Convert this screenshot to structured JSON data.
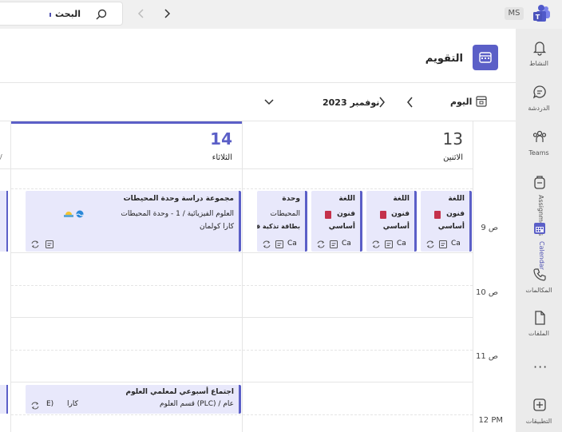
{
  "topbar": {
    "search_label": "البحث",
    "account_badge": "MS"
  },
  "rail": {
    "items": [
      {
        "label": "النشاط",
        "icon": "bell-icon"
      },
      {
        "label": "الدردشة",
        "icon": "chat-icon"
      },
      {
        "label": "Teams",
        "icon": "teams-icon"
      },
      {
        "label": "Assignments",
        "icon": "backpack-icon"
      },
      {
        "label": "Calendar",
        "icon": "calendar-icon"
      },
      {
        "label": "المكالمات",
        "icon": "phone-icon"
      },
      {
        "label": "الملفات",
        "icon": "file-icon"
      },
      {
        "label": "التطبيقات",
        "icon": "add-apps-icon"
      }
    ],
    "more": "···"
  },
  "header": {
    "title": "التقويم"
  },
  "toolbar": {
    "today_label": "اليوم",
    "month_label": "نوفمبر 2023"
  },
  "days": [
    {
      "number": "13",
      "name": "الاثنين"
    },
    {
      "number": "14",
      "name": "الثلاثاء"
    }
  ],
  "times": [
    "9 ص",
    "10 ص",
    "11 ص",
    "12 PM"
  ],
  "events": {
    "mon1": {
      "line1": "اللغة",
      "line2": "فنون",
      "line3": "أساسي",
      "foot": "Ca"
    },
    "mon2": {
      "line1": "اللغة",
      "line2": "فنون",
      "line3": "أساسي",
      "foot": "Ca"
    },
    "tue1": {
      "line1": "اللغة",
      "line2": "فنون",
      "line3": "أساسي",
      "foot": "Ca"
    },
    "tue2": {
      "line1": "وحدة",
      "line2": "المحيطات",
      "line3": "بطاقة تذكية قطبية",
      "foot": "Ca"
    },
    "tue3": {
      "line1": "مجموعة دراسة وحدة المحيطات",
      "line2": "العلوم الفيزيائية / 1 - وحدة المحيطات",
      "line3": "كارا كولمان"
    },
    "tue4": {
      "line1": "اجتماع أسبوعي لمعلمي العلوم",
      "line2": "قسم العلوم (PLC) / عام",
      "line3": "كارا",
      "line4": "E)"
    }
  },
  "colors": {
    "accent": "#5b5fc7",
    "event_bg": "#e8e8fb",
    "rail_bg": "#ebebeb"
  }
}
